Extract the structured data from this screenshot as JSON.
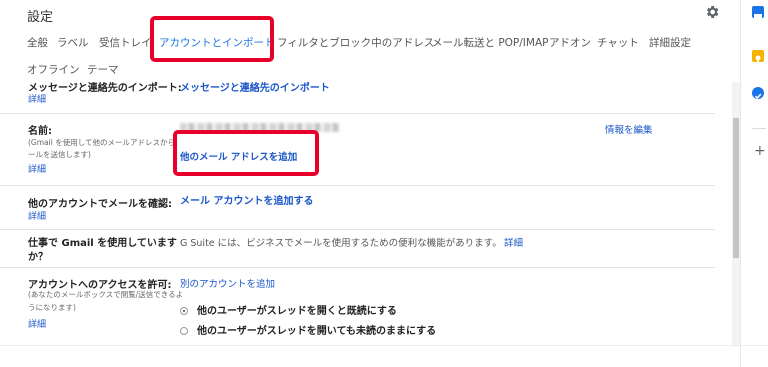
{
  "page_title": "設定",
  "tabs": [
    {
      "label": "全般"
    },
    {
      "label": "ラベル"
    },
    {
      "label": "受信トレイ"
    },
    {
      "label": "アカウントとインポート",
      "active": true
    },
    {
      "label": "フィルタとブロック中のアドレス"
    },
    {
      "label": "メール転送と POP/IMAP"
    },
    {
      "label": "アドオン"
    },
    {
      "label": "チャット"
    },
    {
      "label": "詳細設定"
    },
    {
      "label": "オフライン"
    },
    {
      "label": "テーマ"
    }
  ],
  "sections": {
    "import": {
      "label": "メッセージと連絡先のインポート:",
      "detail": "詳細",
      "link": "メッセージと連絡先のインポート"
    },
    "name": {
      "label": "名前:",
      "sub1": "(Gmail を使用して他のメールアドレスから",
      "sub2": "ールを送信します)",
      "detail": "詳細",
      "add_address": "他のメール アドレスを追加",
      "edit": "情報を編集"
    },
    "check_mail": {
      "label": "他のアカウントでメールを確認:",
      "detail": "詳細",
      "link": "メール アカウントを追加する"
    },
    "work": {
      "label_line1": "仕事で Gmail を使用しています",
      "label_line2": "か？",
      "text": "G Suite には、ビジネスでメールを使用するための便利な機能があります。",
      "link": "詳細"
    },
    "grant": {
      "label": "アカウントへのアクセスを許可:",
      "sub1": "(あなたのメールボックスで閲覧/送信できるよ",
      "sub2": "うになります)",
      "detail": "詳細",
      "link": "別のアカウントを追加",
      "option1": "他のユーザーがスレッドを開くと既読にする",
      "option2": "他のユーザーがスレッドを開いても未読のままにする"
    }
  },
  "colors": {
    "highlight": "#e8002a",
    "link": "#1a56c8",
    "active_tab": "#1a73e8"
  },
  "side_icons": [
    "calendar-icon",
    "keep-icon",
    "tasks-icon",
    "add-icon"
  ]
}
